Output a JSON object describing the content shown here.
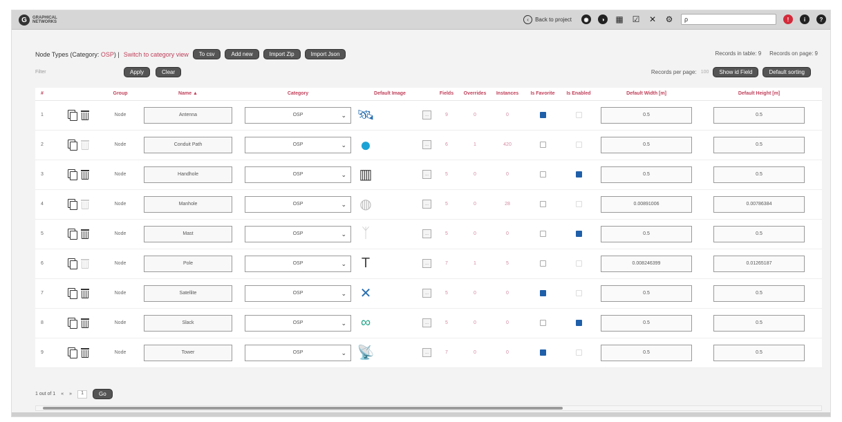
{
  "topbar": {
    "logo_letter": "G",
    "logo_text": "GRAPHICAL NETWORKS",
    "back_label": "Back to project",
    "search_value": "ρ",
    "icons": [
      "globe-icon",
      "overlay-icon",
      "database-icon",
      "checklist-icon",
      "tools-icon",
      "gear-icon",
      "alert-icon",
      "info-icon",
      "help-icon"
    ]
  },
  "header": {
    "title_prefix": "Node Types (Category: ",
    "category": "OSP",
    "title_suffix": ") |",
    "switch_link": "Switch to category view",
    "buttons": [
      "To csv",
      "Add new",
      "Import Zip",
      "Import Json"
    ]
  },
  "records": {
    "in_table": "Records in table: 9",
    "on_page": "Records on page: 9"
  },
  "filter": {
    "label": "Filter",
    "apply": "Apply",
    "clear": "Clear",
    "rpp_label": "Records per page:",
    "rpp_value": "100",
    "show_field": "Show id Field",
    "default_sorting": "Default sorting"
  },
  "columns": [
    "#",
    "",
    "Group",
    "Name ▲",
    "Category",
    "Default Image",
    "",
    "Fields",
    "Overrides",
    "Instances",
    "Is Favorite",
    "Is Enabled",
    "Default Width [m]",
    "Default Height [m]"
  ],
  "rows": [
    {
      "idx": "1",
      "group": "Node",
      "name": "Antenna",
      "category": "OSP",
      "icon": "🛰",
      "icon_name": "antenna-icon",
      "fields": "9",
      "overrides": "0",
      "instances": "0",
      "fav": true,
      "enabled": false,
      "width": "0.5",
      "height": "0.5",
      "del": true
    },
    {
      "idx": "2",
      "group": "Node",
      "name": "Conduit Path",
      "category": "OSP",
      "icon": "●",
      "icon_name": "conduit-icon",
      "fields": "6",
      "overrides": "1",
      "instances": "420",
      "fav": false,
      "enabled": false,
      "width": "0.5",
      "height": "0.5",
      "del": false
    },
    {
      "idx": "3",
      "group": "Node",
      "name": "Handhole",
      "category": "OSP",
      "icon": "▥",
      "icon_name": "handhole-icon",
      "fields": "5",
      "overrides": "0",
      "instances": "0",
      "fav": false,
      "enabled": true,
      "width": "0.5",
      "height": "0.5",
      "del": true
    },
    {
      "idx": "4",
      "group": "Node",
      "name": "Manhole",
      "category": "OSP",
      "icon": "◍",
      "icon_name": "manhole-icon",
      "fields": "5",
      "overrides": "0",
      "instances": "28",
      "fav": false,
      "enabled": false,
      "width": "0.00891006",
      "height": "0.00786384",
      "del": false
    },
    {
      "idx": "5",
      "group": "Node",
      "name": "Mast",
      "category": "OSP",
      "icon": "ᛉ",
      "icon_name": "mast-icon",
      "fields": "5",
      "overrides": "0",
      "instances": "0",
      "fav": false,
      "enabled": true,
      "width": "0.5",
      "height": "0.5",
      "del": true
    },
    {
      "idx": "6",
      "group": "Node",
      "name": "Pole",
      "category": "OSP",
      "icon": "T",
      "icon_name": "pole-icon",
      "fields": "7",
      "overrides": "1",
      "instances": "5",
      "fav": false,
      "enabled": false,
      "width": "0.008246399",
      "height": "0.01265187",
      "del": false
    },
    {
      "idx": "7",
      "group": "Node",
      "name": "Satellite",
      "category": "OSP",
      "icon": "✕",
      "icon_name": "satellite-icon",
      "fields": "5",
      "overrides": "0",
      "instances": "0",
      "fav": true,
      "enabled": false,
      "width": "0.5",
      "height": "0.5",
      "del": true
    },
    {
      "idx": "8",
      "group": "Node",
      "name": "Slack",
      "category": "OSP",
      "icon": "∞",
      "icon_name": "slack-loop-icon",
      "fields": "5",
      "overrides": "0",
      "instances": "0",
      "fav": false,
      "enabled": true,
      "width": "0.5",
      "height": "0.5",
      "del": true
    },
    {
      "idx": "9",
      "group": "Node",
      "name": "Tower",
      "category": "OSP",
      "icon": "📡",
      "icon_name": "tower-icon",
      "fields": "7",
      "overrides": "0",
      "instances": "0",
      "fav": true,
      "enabled": false,
      "width": "0.5",
      "height": "0.5",
      "del": true
    }
  ],
  "pager": {
    "text": "1 out of 1",
    "prev": "«",
    "next": "»",
    "page": "1",
    "go": "Go"
  },
  "colors": {
    "accent": "#c0405a",
    "checkbox": "#1f5fa9",
    "button": "#555555"
  }
}
